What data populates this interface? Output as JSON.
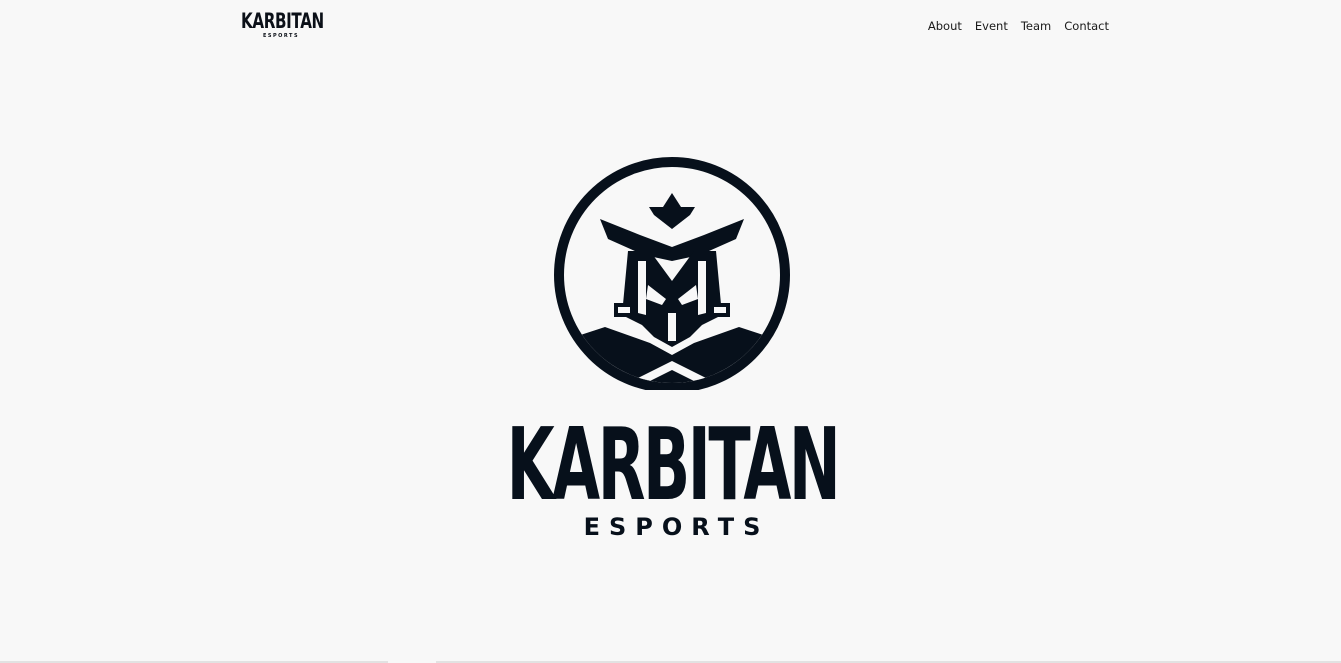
{
  "brand": {
    "name": "KARBITAN",
    "sub": "ESPORTS"
  },
  "nav": {
    "items": [
      {
        "label": "About"
      },
      {
        "label": "Event"
      },
      {
        "label": "Team"
      },
      {
        "label": "Contact"
      }
    ]
  },
  "hero": {
    "name": "KARBITAN",
    "sub": "ESPORTS"
  },
  "colors": {
    "background": "#f8f8f8",
    "logo": "#07101b",
    "nav_text": "#1a1a1a"
  },
  "icons": {
    "emblem": "spartan-helmet-emblem-icon"
  }
}
